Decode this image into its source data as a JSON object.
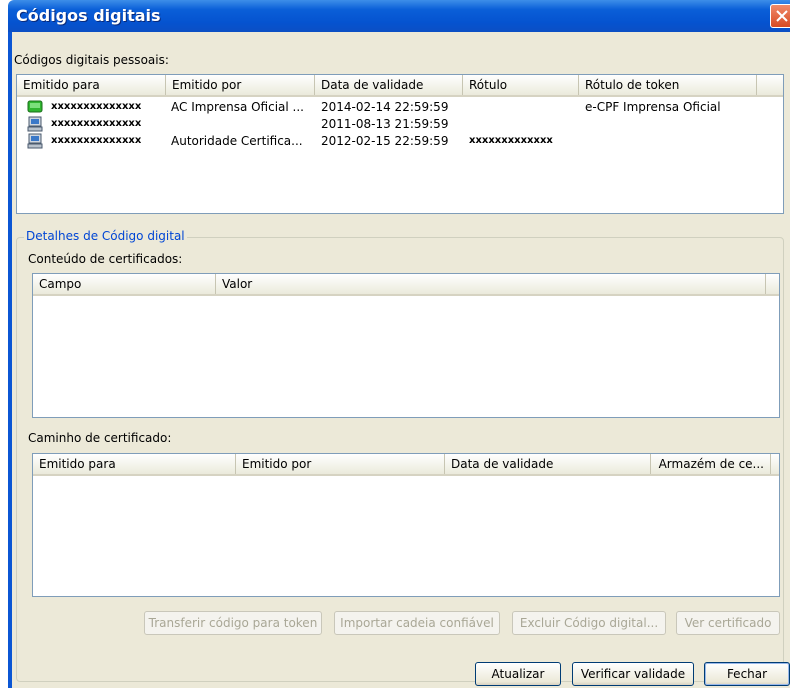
{
  "window": {
    "title": "Códigos digitais"
  },
  "personal": {
    "label": "Códigos digitais pessoais:",
    "columns": [
      "Emitido para",
      "Emitido por",
      "Data de validade",
      "Rótulo",
      "Rótulo de token"
    ],
    "rows": [
      {
        "issued_to": "xxxxxxxxxxxxxx",
        "issued_by": "AC Imprensa Oficial ...",
        "valid_until": "2014-02-14 22:59:59",
        "label": "",
        "token_label": "e-CPF Imprensa Oficial",
        "icon": "smartcard-icon"
      },
      {
        "issued_to": "xxxxxxxxxxxxxx",
        "issued_by": "",
        "valid_until": "2011-08-13 21:59:59",
        "label": "",
        "token_label": "",
        "icon": "computer-icon"
      },
      {
        "issued_to": "xxxxxxxxxxxxxx",
        "issued_by": "Autoridade Certifica...",
        "valid_until": "2012-02-15 22:59:59",
        "label": "xxxxxxxxxxxxx",
        "token_label": "",
        "icon": "computer-icon"
      }
    ]
  },
  "details": {
    "group_label": "Detalhes de Código digital",
    "content_label": "Conteúdo de certificados:",
    "content_columns": [
      "Campo",
      "Valor"
    ],
    "path_label": "Caminho de certificado:",
    "path_columns": [
      "Emitido para",
      "Emitido por",
      "Data de validade",
      "Armazém de ce..."
    ]
  },
  "actions": {
    "transfer": "Transferir código para token",
    "import_chain": "Importar cadeia confiável",
    "delete": "Excluir Código digital...",
    "view": "Ver certificado"
  },
  "footer": {
    "refresh": "Atualizar",
    "verify": "Verificar validade",
    "close": "Fechar"
  },
  "colors": {
    "title_bar": "#0553d0",
    "client_bg": "#ece9d8",
    "group_label": "#0046d5"
  }
}
